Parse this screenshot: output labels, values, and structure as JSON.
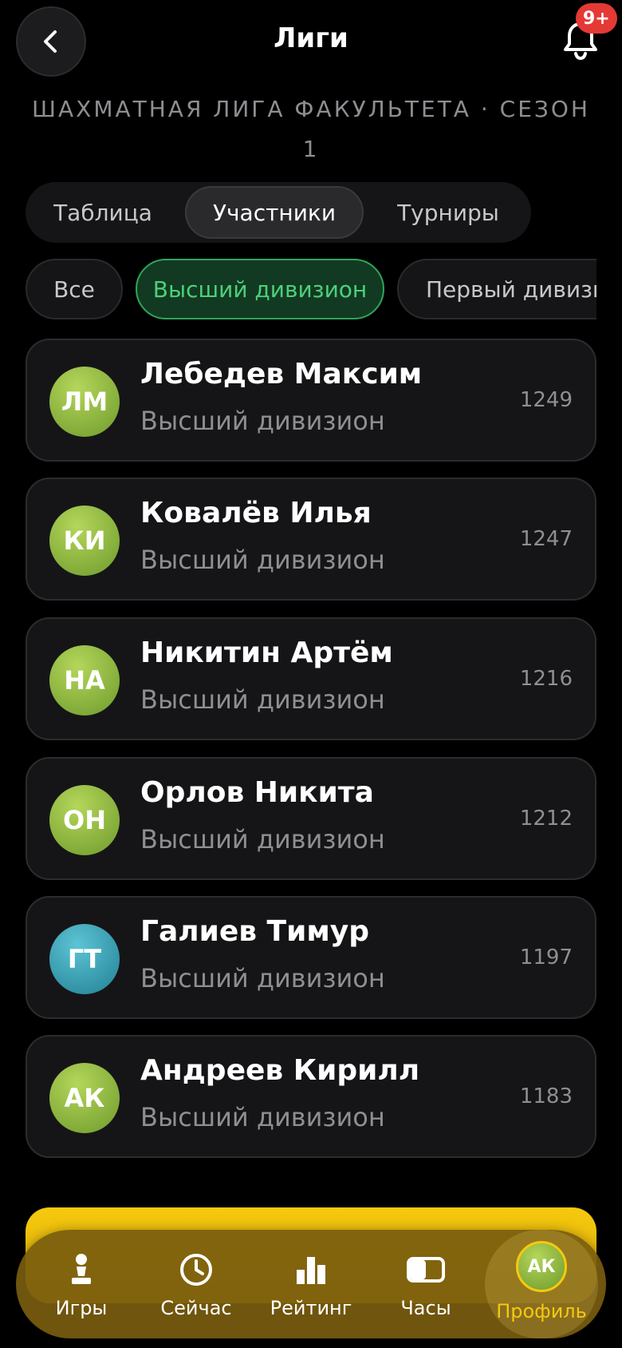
{
  "header": {
    "title": "Лиги",
    "notification_badge": "9+"
  },
  "league": {
    "subtitle": "ШАХМАТНАЯ ЛИГА ФАКУЛЬТЕТА · СЕЗОН 1"
  },
  "tabs": [
    {
      "label": "Таблица",
      "active": false
    },
    {
      "label": "Участники",
      "active": true
    },
    {
      "label": "Турниры",
      "active": false
    }
  ],
  "filters": [
    {
      "label": "Все",
      "active": false
    },
    {
      "label": "Высший дивизион",
      "active": true
    },
    {
      "label": "Первый дивизион",
      "active": false
    }
  ],
  "participants": [
    {
      "initials": "ЛМ",
      "name": "Лебедев Максим",
      "division": "Высший дивизион",
      "rating": "1249",
      "avatar_color": "green"
    },
    {
      "initials": "КИ",
      "name": "Ковалёв Илья",
      "division": "Высший дивизион",
      "rating": "1247",
      "avatar_color": "green"
    },
    {
      "initials": "НА",
      "name": "Никитин Артём",
      "division": "Высший дивизион",
      "rating": "1216",
      "avatar_color": "green"
    },
    {
      "initials": "ОН",
      "name": "Орлов Никита",
      "division": "Высший дивизион",
      "rating": "1212",
      "avatar_color": "green"
    },
    {
      "initials": "ГТ",
      "name": "Галиев Тимур",
      "division": "Высший дивизион",
      "rating": "1197",
      "avatar_color": "teal"
    },
    {
      "initials": "АК",
      "name": "Андреев Кирилл",
      "division": "Высший дивизион",
      "rating": "1183",
      "avatar_color": "green"
    }
  ],
  "colors": {
    "accent_green": "#4cd07a",
    "accent_yellow": "#f6c90e",
    "badge_red": "#e53935"
  },
  "bottom_nav": [
    {
      "label": "Игры",
      "icon": "pawn-icon"
    },
    {
      "label": "Сейчас",
      "icon": "clock-icon"
    },
    {
      "label": "Рейтинг",
      "icon": "bar-chart-icon"
    },
    {
      "label": "Часы",
      "icon": "chess-clock-icon"
    },
    {
      "label": "Профиль",
      "icon": "avatar",
      "initials": "АК",
      "active": true
    }
  ]
}
